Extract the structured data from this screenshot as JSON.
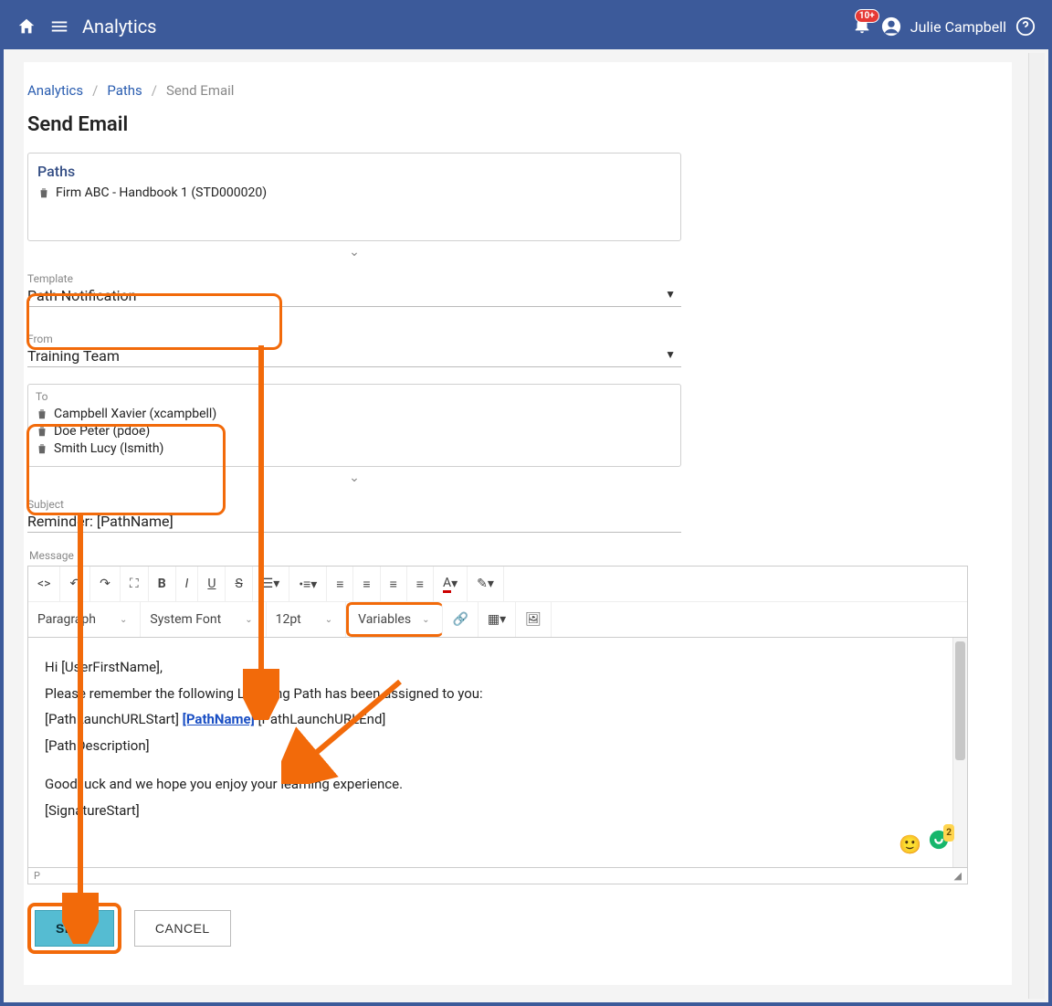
{
  "appbar": {
    "title": "Analytics",
    "notification_count": "10+",
    "user_name": "Julie Campbell"
  },
  "breadcrumbs": {
    "items": [
      "Analytics",
      "Paths",
      "Send Email"
    ]
  },
  "page_title": "Send Email",
  "paths_card": {
    "label": "Paths",
    "items": [
      "Firm ABC - Handbook 1 (STD000020)"
    ]
  },
  "template_field": {
    "label": "Template",
    "value": "Path Notification"
  },
  "from_field": {
    "label": "From",
    "value": "Training Team"
  },
  "to_field": {
    "label": "To",
    "recipients": [
      "Campbell Xavier (xcampbell)",
      "Doe Peter (pdoe)",
      "Smith Lucy (lsmith)"
    ]
  },
  "subject_field": {
    "label": "Subject",
    "value": "Reminder: [PathName]"
  },
  "message_label": "Message",
  "toolbar": {
    "block": "Paragraph",
    "font": "System Font",
    "size": "12pt",
    "variables_label": "Variables"
  },
  "editor": {
    "line1": "Hi [UserFirstName],",
    "line2": "Please remember the following Learning Path has been assigned to you:",
    "line3_a": "[PathLaunchURLStart] ",
    "line3_b": "[PathName]",
    "line3_c": " [PathLaunchURLEnd]",
    "line4": "[PathDescription]",
    "line5": "Good luck and we hope you enjoy your learning experience.",
    "line6": "[SignatureStart]",
    "path_indicator": "P"
  },
  "buttons": {
    "send": "SEND",
    "cancel": "CANCEL"
  },
  "grammarly_badge": "2"
}
